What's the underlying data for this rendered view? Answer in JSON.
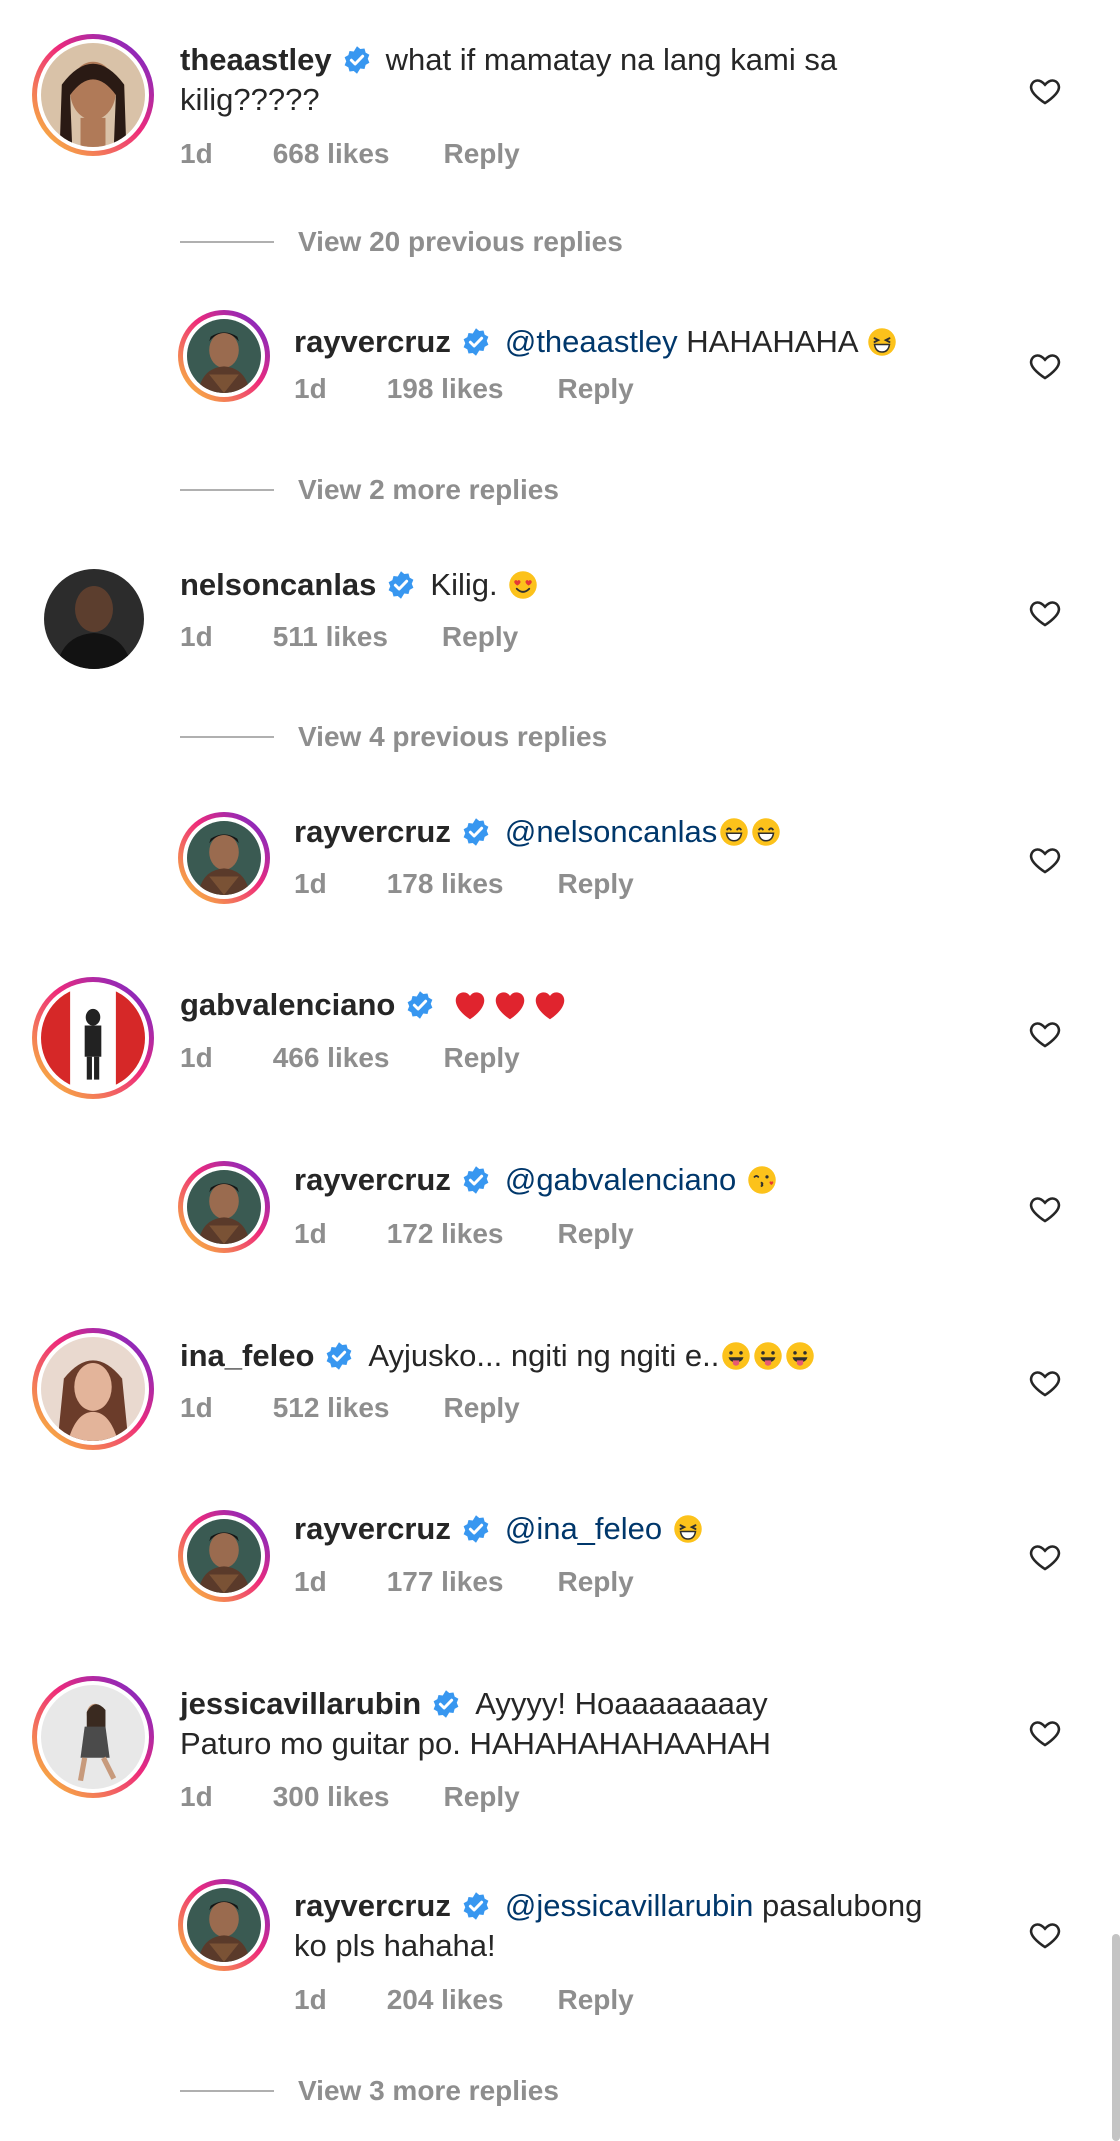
{
  "threads": [
    {
      "username": "theaastley",
      "text_line1": "what if mamatay na lang kami sa",
      "text_line2": "kilig?????",
      "time": "1d",
      "likes": "668 likes",
      "reply": "Reply",
      "avatar": "woman-portrait"
    },
    {
      "view_replies": "View 20 previous replies"
    },
    {
      "username": "rayvercruz",
      "mention": "@theaastley",
      "text": " HAHAHAHA",
      "emoji": [
        "grinning-squint-face"
      ],
      "time": "1d",
      "likes": "198 likes",
      "reply": "Reply"
    },
    {
      "view_replies": "View 2 more replies"
    },
    {
      "username": "nelsoncanlas",
      "text": "Kilig.",
      "emoji": [
        "heart-eyes-face"
      ],
      "time": "1d",
      "likes": "511 likes",
      "reply": "Reply"
    },
    {
      "view_replies": "View 4 previous replies"
    },
    {
      "username": "rayvercruz",
      "mention": "@nelsoncanlas",
      "emoji": [
        "grinning-face",
        "grinning-face"
      ],
      "time": "1d",
      "likes": "178 likes",
      "reply": "Reply"
    },
    {
      "username": "gabvalenciano",
      "emoji": [
        "red-heart",
        "red-heart",
        "red-heart"
      ],
      "time": "1d",
      "likes": "466 likes",
      "reply": "Reply"
    },
    {
      "username": "rayvercruz",
      "mention": "@gabvalenciano",
      "emoji": [
        "kiss-face"
      ],
      "time": "1d",
      "likes": "172 likes",
      "reply": "Reply"
    },
    {
      "username": "ina_feleo",
      "text": "Ayjusko... ngiti ng ngiti e..",
      "emoji": [
        "tongue-face",
        "tongue-face",
        "tongue-face"
      ],
      "time": "1d",
      "likes": "512 likes",
      "reply": "Reply"
    },
    {
      "username": "rayvercruz",
      "mention": "@ina_feleo",
      "emoji": [
        "grinning-squint-face"
      ],
      "time": "1d",
      "likes": "177 likes",
      "reply": "Reply"
    },
    {
      "username": "jessicavillarubin",
      "text_line1": "Ayyyy! Hoaaaaaaaay",
      "text_line2": "Paturo mo guitar po. HAHAHAHAHAAHAH",
      "time": "1d",
      "likes": "300 likes",
      "reply": "Reply"
    },
    {
      "username": "rayvercruz",
      "mention": "@jessicavillarubin",
      "text_line1_rest": " pasalubong",
      "text_line2": "ko pls hahaha!",
      "time": "1d",
      "likes": "204 likes",
      "reply": "Reply"
    },
    {
      "view_replies": "View 3 more replies"
    }
  ],
  "colors": {
    "verified": "#3897f0",
    "mention": "#00376b",
    "meta": "#8e8e8e",
    "text": "#262626"
  },
  "icons": {
    "like": "heart-outline-icon",
    "verified": "verified-badge-icon"
  }
}
